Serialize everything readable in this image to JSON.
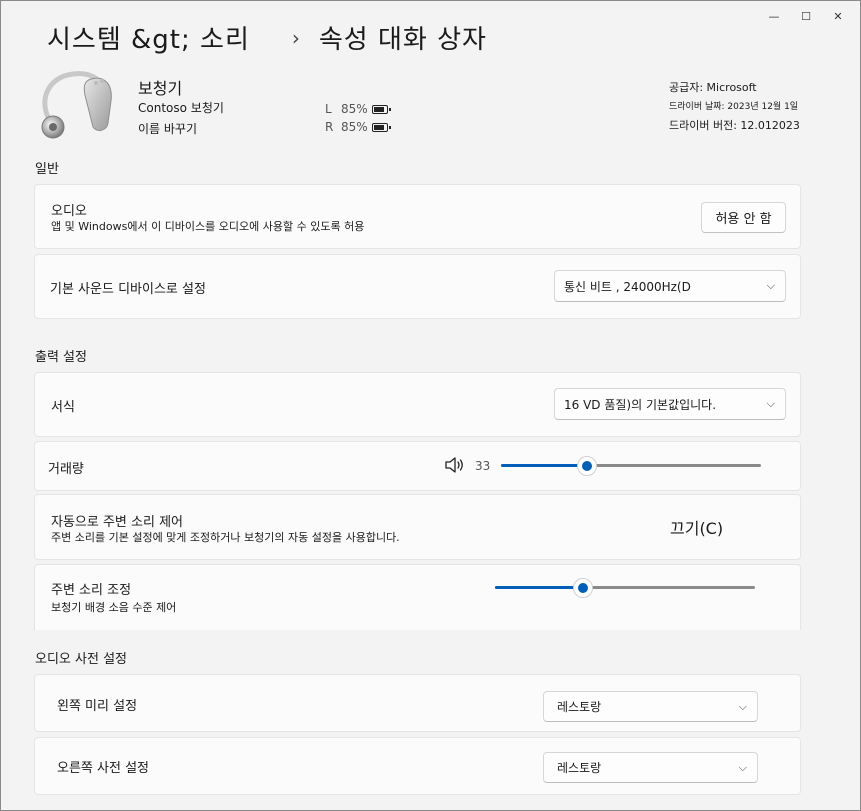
{
  "window": {
    "controls": {
      "minimize": "—",
      "maximize": "☐",
      "close": "✕"
    }
  },
  "breadcrumb": {
    "parent": "시스템 &gt;  소리",
    "separator": "›",
    "current": "속성 대화 상자"
  },
  "device": {
    "icon": "hearing-aid-icon",
    "name": "보청기",
    "model": "Contoso 보청기",
    "rename": "이름 바꾸기",
    "battery_left": {
      "side": "L",
      "percent": "85%",
      "level": 0.85
    },
    "battery_right": {
      "side": "R",
      "percent": "85%",
      "level": 0.85
    }
  },
  "info": {
    "provider": "공급자: Microsoft",
    "driver_date": "드라이버 날짜: 2023년 12월 1일",
    "driver_version": "드라이버 버전: 12.012023"
  },
  "sections": {
    "general": "일반",
    "output": "출력 설정",
    "presets": "오디오 사전 설정"
  },
  "audio": {
    "title": "오디오",
    "description": "앱 및 Windows에서 이 디바이스를 오디오에 사용할 수 있도록 허용",
    "button": "허용 안 함"
  },
  "default_device": {
    "title": "기본 사운드 디바이스로 설정",
    "value": "통신 비트 , 24000Hz(D"
  },
  "format": {
    "title": "서식",
    "value": "16 VD 품질)의 기본값입니다."
  },
  "volume": {
    "title": "거래량",
    "icon": "speaker-icon",
    "value": "33",
    "level": 0.33
  },
  "ambient_control": {
    "title": "자동으로 주변 소리 제어",
    "description": "주변 소리를 기본 설정에 맞게 조정하거나 보청기의 자동 설정을 사용합니다.",
    "state": "끄기(C)"
  },
  "ambient_adjust": {
    "title": "주변 소리 조정",
    "description": "보청기 배경 소음 수준 제어",
    "level": 0.34
  },
  "presets": {
    "left": {
      "title": "왼쪽 미리 설정",
      "value": "레스토랑"
    },
    "right": {
      "title": "오른쪽 사전 설정",
      "value": "레스토랑"
    }
  },
  "colors": {
    "accent": "#005fb8",
    "track": "#8a8a8a"
  }
}
